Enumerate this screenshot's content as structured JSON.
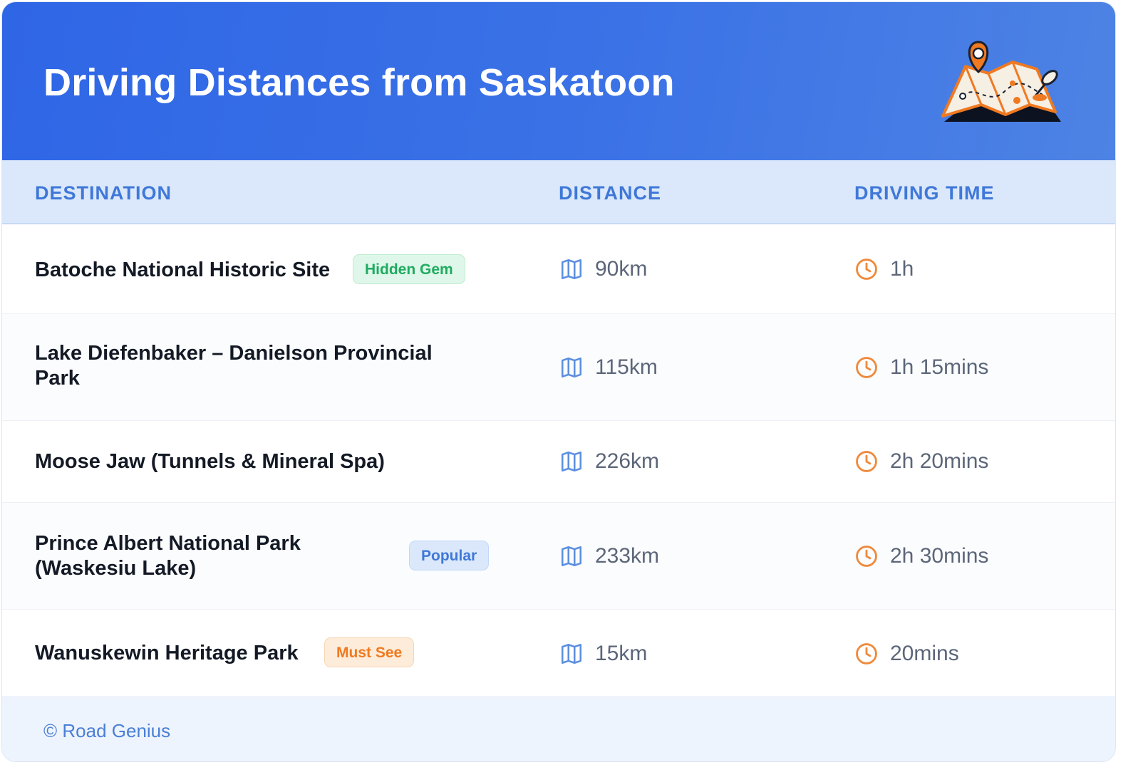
{
  "header": {
    "title": "Driving Distances from Saskatoon",
    "illustration_icon": "map-with-location-pin-icon"
  },
  "columns": {
    "destination": "DESTINATION",
    "distance": "DISTANCE",
    "driving_time": "DRIVING TIME"
  },
  "icons": {
    "distance": "map-icon",
    "time": "clock-icon"
  },
  "rows": [
    {
      "destination": "Batoche National Historic Site",
      "badge": "Hidden Gem",
      "badge_type": "hidden-gem",
      "distance": "90km",
      "time": "1h"
    },
    {
      "destination": "Lake Diefenbaker – Danielson Provincial Park",
      "badge": "",
      "badge_type": "",
      "distance": "115km",
      "time": "1h 15mins"
    },
    {
      "destination": "Moose Jaw (Tunnels & Mineral Spa)",
      "badge": "",
      "badge_type": "",
      "distance": "226km",
      "time": "2h 20mins"
    },
    {
      "destination": "Prince Albert National Park (Waskesiu Lake)",
      "badge": "Popular",
      "badge_type": "popular",
      "distance": "233km",
      "time": "2h 30mins"
    },
    {
      "destination": "Wanuskewin Heritage Park",
      "badge": "Must See",
      "badge_type": "must-see",
      "distance": "15km",
      "time": "20mins"
    }
  ],
  "footer": {
    "credit": "© Road Genius"
  },
  "colors": {
    "header_gradient_start": "#2f66e6",
    "header_gradient_end": "#4d83e4",
    "column_header_bg": "#dbe8fb",
    "column_header_text": "#3f78d8",
    "distance_icon": "#5b8fe0",
    "time_icon": "#ef8a3c",
    "hidden_gem_bg": "#dff7ea",
    "hidden_gem_text": "#1fab60",
    "popular_bg": "#dbe8fb",
    "popular_text": "#3f78d8",
    "must_see_bg": "#fdecd9",
    "must_see_text": "#ef7a22"
  }
}
